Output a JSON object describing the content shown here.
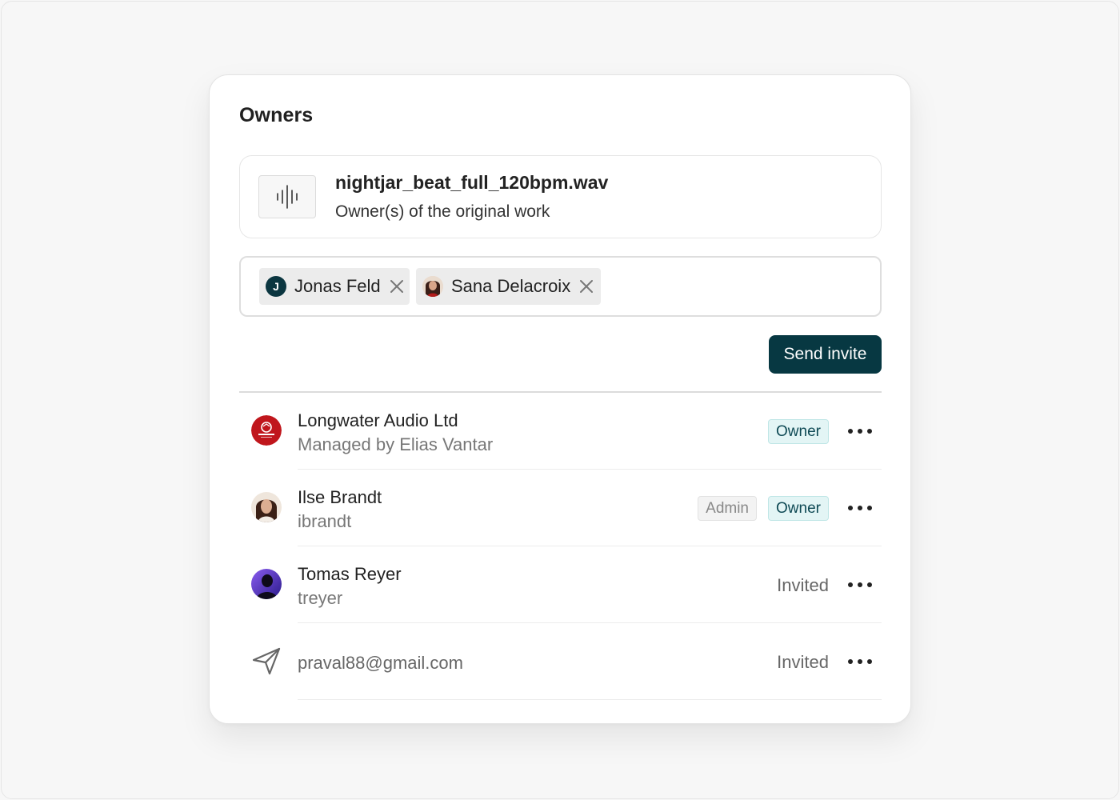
{
  "panel": {
    "title": "Owners"
  },
  "file": {
    "name": "nightjar_beat_full_120bpm.wav",
    "subtitle": "Owner(s) of the original work",
    "icon": "audio-waveform-icon"
  },
  "tag_input": {
    "chips": [
      {
        "label": "Jonas Feld",
        "avatar_initial": "J",
        "avatar_color": "#0b3640"
      },
      {
        "label": "Sana Delacroix",
        "avatar": "photo"
      }
    ]
  },
  "actions": {
    "send_invite": "Send invite"
  },
  "members": [
    {
      "name": "Longwater Audio Ltd",
      "subtitle": "Managed by Elias Vantar",
      "avatar": "company-logo",
      "avatar_color": "#c0161c",
      "badges": [
        "Owner"
      ]
    },
    {
      "name": "Ilse Brandt",
      "subtitle": "ibrandt",
      "avatar": "photo",
      "badges": [
        "Admin",
        "Owner"
      ]
    },
    {
      "name": "Tomas Reyer",
      "subtitle": "treyer",
      "avatar": "photo",
      "status": "Invited"
    },
    {
      "email": "praval88@gmail.com",
      "avatar": "send-icon",
      "status": "Invited"
    }
  ],
  "colors": {
    "primary": "#073842",
    "owner_badge_bg": "#e3f5f5",
    "admin_badge_bg": "#f3f3f3"
  }
}
